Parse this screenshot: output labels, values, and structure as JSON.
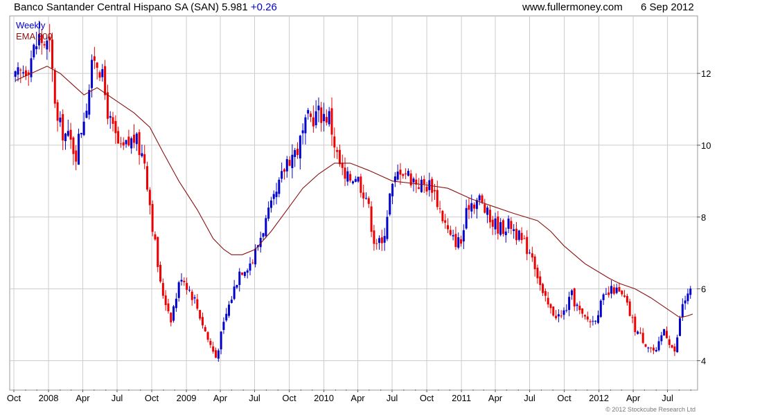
{
  "header": {
    "title": "Banco Santander Central Hispano SA (SAN) 5.981",
    "change": "+0.26",
    "site": "www.fullermoney.com",
    "date": "6 Sep 2012"
  },
  "footer": {
    "copyright": "© 2012 Stockcube Research Ltd"
  },
  "colors": {
    "up": "#0000cc",
    "down": "#ee0000",
    "ema": "#8b1010",
    "grid": "#cccccc"
  },
  "chart_data": {
    "type": "candlestick",
    "frequency": "Weekly",
    "legend": [
      "Weekly",
      "EMA 200"
    ],
    "x_labels": [
      "Oct",
      "2008",
      "Apr",
      "Jul",
      "Oct",
      "2009",
      "Apr",
      "Jul",
      "Oct",
      "2010",
      "Apr",
      "Jul",
      "Oct",
      "2011",
      "Apr",
      "Jul",
      "Oct",
      "2012",
      "Apr",
      "Jul"
    ],
    "x_range": [
      "2007-10-01",
      "2012-09-06"
    ],
    "y_ticks": [
      4,
      6,
      8,
      10,
      12
    ],
    "y_range": [
      3.2,
      13.6
    ],
    "price_waypoints": [
      [
        "2007-10-05",
        11.8
      ],
      [
        "2007-11-09",
        12.3
      ],
      [
        "2007-12-07",
        13.0
      ],
      [
        "2008-01-04",
        12.7
      ],
      [
        "2008-01-25",
        10.6
      ],
      [
        "2008-02-22",
        10.2
      ],
      [
        "2008-03-14",
        9.8
      ],
      [
        "2008-04-11",
        11.2
      ],
      [
        "2008-05-02",
        12.5
      ],
      [
        "2008-05-16",
        12.2
      ],
      [
        "2008-06-13",
        10.6
      ],
      [
        "2008-07-11",
        9.8
      ],
      [
        "2008-08-15",
        10.2
      ],
      [
        "2008-09-12",
        9.6
      ],
      [
        "2008-10-03",
        7.8
      ],
      [
        "2008-10-24",
        6.1
      ],
      [
        "2008-11-21",
        5.2
      ],
      [
        "2008-12-19",
        6.4
      ],
      [
        "2009-01-23",
        5.7
      ],
      [
        "2009-02-27",
        4.6
      ],
      [
        "2009-03-20",
        4.1
      ],
      [
        "2009-04-17",
        5.3
      ],
      [
        "2009-05-22",
        6.5
      ],
      [
        "2009-06-26",
        6.8
      ],
      [
        "2009-07-24",
        7.7
      ],
      [
        "2009-08-28",
        8.6
      ],
      [
        "2009-09-25",
        9.6
      ],
      [
        "2009-10-23",
        9.9
      ],
      [
        "2009-11-20",
        10.7
      ],
      [
        "2009-12-18",
        10.9
      ],
      [
        "2010-01-15",
        10.8
      ],
      [
        "2010-02-05",
        9.7
      ],
      [
        "2010-02-26",
        9.0
      ],
      [
        "2010-03-26",
        9.2
      ],
      [
        "2010-04-23",
        8.6
      ],
      [
        "2010-05-14",
        7.4
      ],
      [
        "2010-06-04",
        7.2
      ],
      [
        "2010-06-25",
        8.6
      ],
      [
        "2010-07-23",
        9.4
      ],
      [
        "2010-08-20",
        9.1
      ],
      [
        "2010-09-17",
        8.9
      ],
      [
        "2010-10-15",
        8.9
      ],
      [
        "2010-11-12",
        8.0
      ],
      [
        "2010-12-03",
        7.4
      ],
      [
        "2010-12-31",
        7.3
      ],
      [
        "2011-01-21",
        8.4
      ],
      [
        "2011-02-18",
        8.5
      ],
      [
        "2011-03-18",
        7.9
      ],
      [
        "2011-04-15",
        7.7
      ],
      [
        "2011-05-13",
        7.8
      ],
      [
        "2011-06-10",
        7.3
      ],
      [
        "2011-07-08",
        7.0
      ],
      [
        "2011-08-05",
        5.8
      ],
      [
        "2011-08-26",
        5.4
      ],
      [
        "2011-09-23",
        5.2
      ],
      [
        "2011-10-21",
        5.8
      ],
      [
        "2011-11-18",
        5.2
      ],
      [
        "2011-12-16",
        5.1
      ],
      [
        "2012-01-13",
        5.7
      ],
      [
        "2012-02-10",
        6.0
      ],
      [
        "2012-03-09",
        5.7
      ],
      [
        "2012-04-06",
        4.9
      ],
      [
        "2012-05-04",
        4.5
      ],
      [
        "2012-06-01",
        4.2
      ],
      [
        "2012-06-22",
        4.9
      ],
      [
        "2012-07-20",
        4.2
      ],
      [
        "2012-08-10",
        5.6
      ],
      [
        "2012-09-06",
        5.98
      ]
    ],
    "ema_waypoints": [
      [
        "2007-10-05",
        11.8
      ],
      [
        "2007-11-16",
        12.0
      ],
      [
        "2007-12-28",
        12.2
      ],
      [
        "2008-02-01",
        12.0
      ],
      [
        "2008-03-14",
        11.6
      ],
      [
        "2008-04-04",
        11.4
      ],
      [
        "2008-05-09",
        11.6
      ],
      [
        "2008-06-20",
        11.3
      ],
      [
        "2008-08-15",
        10.9
      ],
      [
        "2008-09-26",
        10.5
      ],
      [
        "2008-10-31",
        9.8
      ],
      [
        "2008-12-12",
        9.0
      ],
      [
        "2009-01-30",
        8.2
      ],
      [
        "2009-03-13",
        7.4
      ],
      [
        "2009-04-10",
        7.1
      ],
      [
        "2009-05-01",
        6.95
      ],
      [
        "2009-05-29",
        6.95
      ],
      [
        "2009-07-03",
        7.1
      ],
      [
        "2009-08-14",
        7.6
      ],
      [
        "2009-09-25",
        8.2
      ],
      [
        "2009-11-06",
        8.8
      ],
      [
        "2009-12-18",
        9.2
      ],
      [
        "2010-01-29",
        9.5
      ],
      [
        "2010-03-12",
        9.5
      ],
      [
        "2010-04-30",
        9.3
      ],
      [
        "2010-07-02",
        9.0
      ],
      [
        "2010-09-24",
        8.9
      ],
      [
        "2010-11-26",
        8.8
      ],
      [
        "2011-01-28",
        8.5
      ],
      [
        "2011-03-25",
        8.3
      ],
      [
        "2011-05-20",
        8.1
      ],
      [
        "2011-07-22",
        7.9
      ],
      [
        "2011-08-26",
        7.6
      ],
      [
        "2011-09-30",
        7.2
      ],
      [
        "2011-11-25",
        6.7
      ],
      [
        "2012-01-27",
        6.3
      ],
      [
        "2012-02-24",
        6.15
      ],
      [
        "2012-04-06",
        6.0
      ],
      [
        "2012-05-18",
        5.75
      ],
      [
        "2012-07-06",
        5.4
      ],
      [
        "2012-08-03",
        5.2
      ],
      [
        "2012-08-24",
        5.25
      ],
      [
        "2012-09-06",
        5.3
      ]
    ]
  }
}
